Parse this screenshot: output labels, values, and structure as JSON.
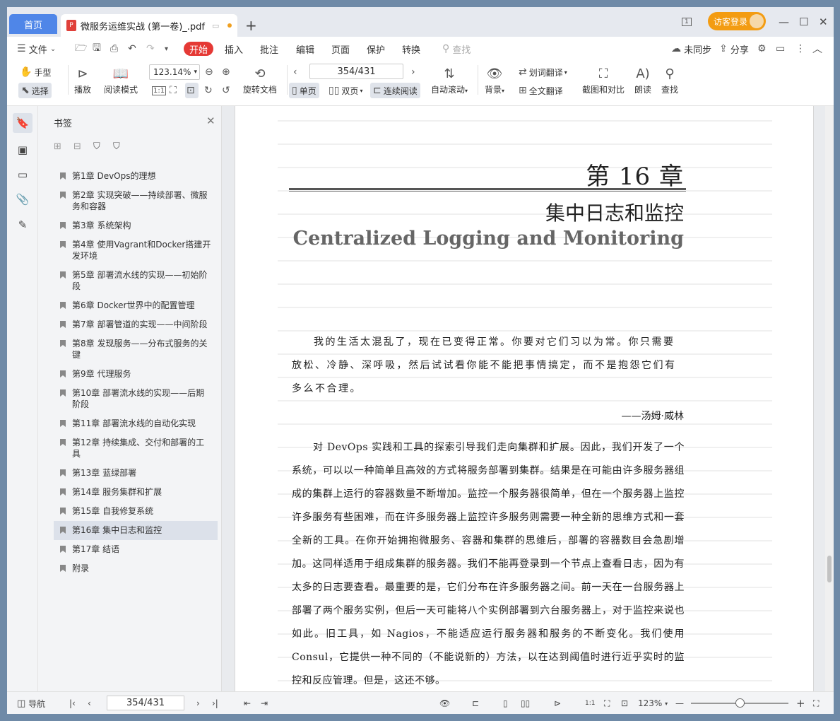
{
  "tabs": {
    "home": "首页",
    "doc_title": "微服务运维实战 (第一卷)_.pdf",
    "new_tab": "+"
  },
  "titlebar": {
    "login": "访客登录",
    "page_count_icon": "1"
  },
  "menu": {
    "file": "文件",
    "start": "开始",
    "insert": "插入",
    "annotate": "批注",
    "edit": "编辑",
    "page": "页面",
    "protect": "保护",
    "convert": "转换",
    "search_placeholder": "查找",
    "sync": "未同步",
    "share": "分享"
  },
  "toolbar": {
    "hand": "手型",
    "select": "选择",
    "play": "播放",
    "read_mode": "阅读模式",
    "zoom": "123.14%",
    "rotate_doc": "旋转文档",
    "page_indicator": "354/431",
    "single_page": "单页",
    "double_page": "双页",
    "continuous": "连续阅读",
    "auto_scroll": "自动滚动",
    "background": "背景",
    "word_translate": "划词翻译",
    "full_translate": "全文翻译",
    "screenshot_compare": "截图和对比",
    "read_aloud": "朗读",
    "find": "查找"
  },
  "panel": {
    "title": "书签",
    "bookmarks": [
      {
        "label": "第1章  DevOps的理想"
      },
      {
        "label": "第2章  实现突破——持续部署、微服务和容器"
      },
      {
        "label": "第3章  系统架构"
      },
      {
        "label": "第4章  使用Vagrant和Docker搭建开发环境"
      },
      {
        "label": "第5章  部署流水线的实现——初始阶段"
      },
      {
        "label": "第6章  Docker世界中的配置管理"
      },
      {
        "label": "第7章  部署管道的实现——中间阶段"
      },
      {
        "label": "第8章  发现服务——分布式服务的关键"
      },
      {
        "label": "第9章  代理服务"
      },
      {
        "label": "第10章  部署流水线的实现——后期阶段"
      },
      {
        "label": "第11章  部署流水线的自动化实现"
      },
      {
        "label": "第12章  持续集成、交付和部署的工具"
      },
      {
        "label": "第13章  蓝绿部署"
      },
      {
        "label": "第14章  服务集群和扩展"
      },
      {
        "label": "第15章  自我修复系统"
      },
      {
        "label": "第16章  集中日志和监控",
        "active": true
      },
      {
        "label": "第17章  结语"
      },
      {
        "label": "附录"
      }
    ]
  },
  "document": {
    "chapter_no": "第 16 章",
    "chapter_title_zh": "集中日志和监控",
    "chapter_title_en": "Centralized Logging and Monitoring",
    "epigraph": "我的生活太混乱了，现在已变得正常。你要对它们习以为常。你只需要放松、冷静、深呼吸，然后试试看你能不能把事情搞定，而不是抱怨它们有多么不合理。",
    "epigraph_author": "——汤姆·威林",
    "body": "对 DevOps 实践和工具的探索引导我们走向集群和扩展。因此，我们开发了一个系统，可以以一种简单且高效的方式将服务部署到集群。结果是在可能由许多服务器组成的集群上运行的容器数量不断增加。监控一个服务器很简单，但在一个服务器上监控许多服务有些困难，而在许多服务器上监控许多服务则需要一种全新的思维方式和一套全新的工具。在你开始拥抱微服务、容器和集群的思维后，部署的容器数目会急剧增加。这同样适用于组成集群的服务器。我们不能再登录到一个节点上查看日志，因为有太多的日志要查看。最重要的是，它们分布在许多服务器之间。前一天在一台服务器上部署了两个服务实例，但后一天可能将八个实例部署到六台服务器上，对于监控来说也如此。旧工具，如 Nagios，不能适应运行服务器和服务的不断变化。我们使用 Consul，它提供一种不同的（不能说新的）方法，以在达到阈值时进行近乎实时的监控和反应管理。但是，这还不够。"
  },
  "statusbar": {
    "nav": "导航",
    "page": "354/431",
    "zoom": "123%"
  },
  "colors": {
    "accent": "#4f86e8",
    "start": "#e53935",
    "login": "#f39c12"
  }
}
